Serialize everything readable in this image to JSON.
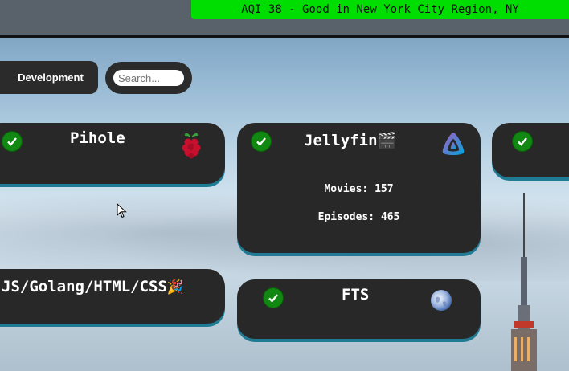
{
  "aqi": {
    "text": "AQI 38 - Good in New York City Region, NY",
    "color": "#00dd00"
  },
  "nav": {
    "development_label": "Development"
  },
  "search": {
    "placeholder": "Search..."
  },
  "cards": {
    "pihole": {
      "title": "Pihole",
      "icon": "raspberry-pi-icon"
    },
    "jellyfin": {
      "title": "Jellyfin",
      "emoji": "🎬",
      "icon": "jellyfin-icon",
      "movies": "Movies: 157",
      "episodes": "Episodes: 465"
    },
    "js": {
      "title": "JS/Golang/HTML/CSS",
      "emoji": "🎉"
    },
    "fts": {
      "title": "FTS",
      "icon": "globe-icon"
    }
  },
  "colors": {
    "card_bg": "#282828",
    "card_shadow": "#1f7a94",
    "status_ok": "#118811"
  }
}
